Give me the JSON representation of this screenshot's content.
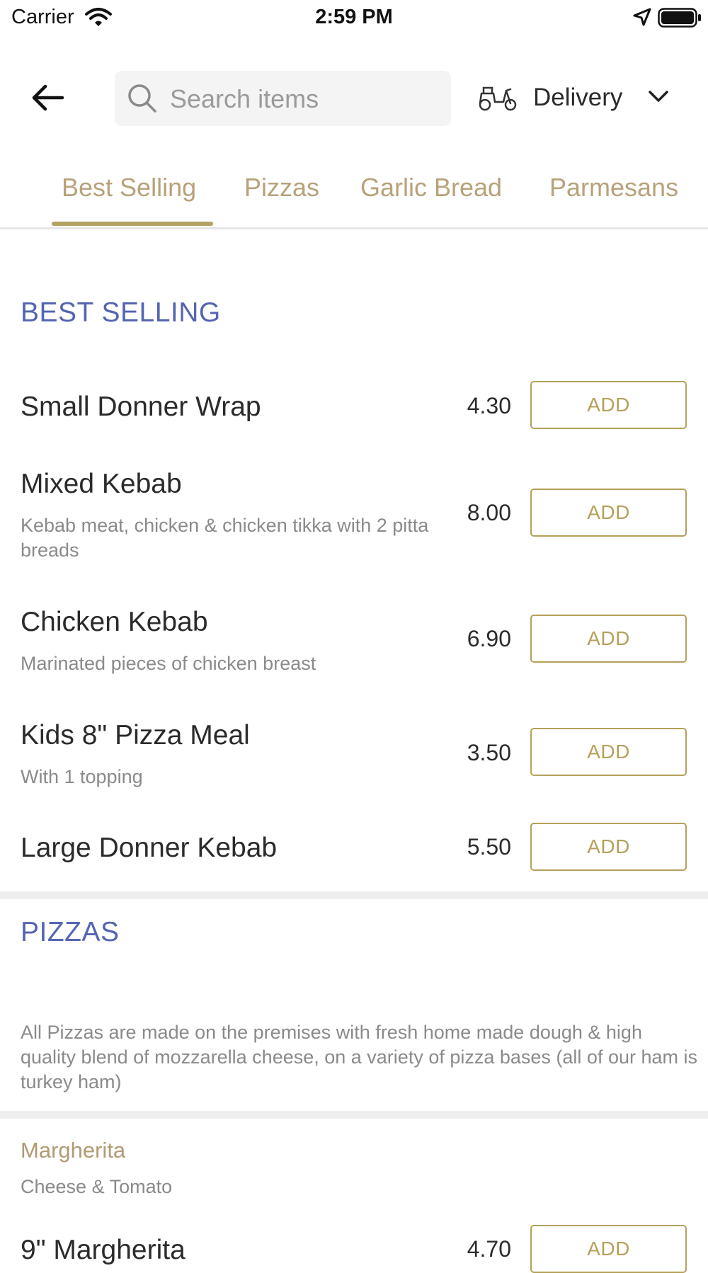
{
  "status_bar": {
    "carrier": "Carrier",
    "time": "2:59 PM"
  },
  "header": {
    "search_placeholder": "Search items",
    "delivery_label": "Delivery"
  },
  "tabs": [
    {
      "label": "Best Selling",
      "active": true
    },
    {
      "label": "Pizzas",
      "active": false
    },
    {
      "label": "Garlic Bread",
      "active": false
    },
    {
      "label": "Parmesans",
      "active": false
    }
  ],
  "best_selling": {
    "title": "BEST SELLING",
    "items": [
      {
        "name": "Small Donner Wrap",
        "description": "",
        "price": "4.30",
        "button": "ADD"
      },
      {
        "name": "Mixed Kebab",
        "description": "Kebab meat, chicken & chicken tikka with 2 pitta breads",
        "price": "8.00",
        "button": "ADD"
      },
      {
        "name": "Chicken Kebab",
        "description": "Marinated pieces of chicken breast",
        "price": "6.90",
        "button": "ADD"
      },
      {
        "name": "Kids 8\" Pizza Meal",
        "description": "With 1 topping",
        "price": "3.50",
        "button": "ADD"
      },
      {
        "name": "Large Donner Kebab",
        "description": "",
        "price": "5.50",
        "button": "ADD"
      }
    ]
  },
  "pizzas": {
    "title": "PIZZAS",
    "note": "All Pizzas are made on the premises with fresh home made dough & high quality blend of mozzarella cheese, on a variety of pizza bases (all of our ham is turkey ham)",
    "subsection": {
      "title": "Margherita",
      "description": "Cheese & Tomato",
      "items": [
        {
          "name": "9\" Margherita",
          "price": "4.70",
          "button": "ADD"
        }
      ]
    }
  },
  "colors": {
    "accent_gold": "#b5a15a",
    "tab_text": "#b8a27a",
    "section_blue": "#5565b3"
  },
  "icons": [
    "wifi-icon",
    "location-arrow-icon",
    "battery-icon",
    "back-arrow-icon",
    "search-icon",
    "scooter-icon",
    "chevron-down-icon"
  ]
}
